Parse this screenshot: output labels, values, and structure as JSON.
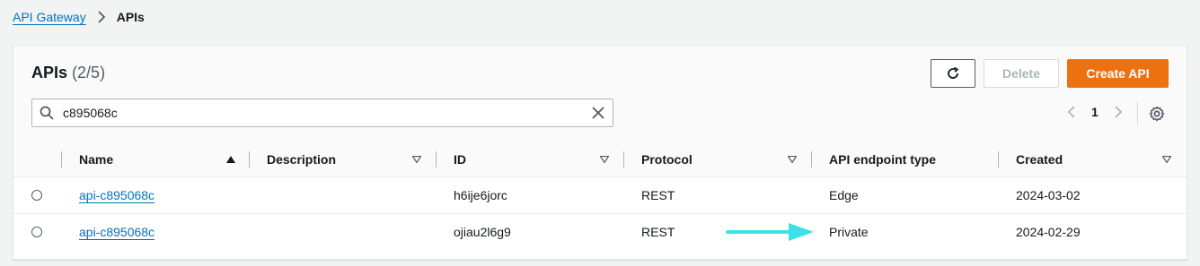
{
  "breadcrumb": {
    "root": "API Gateway",
    "current": "APIs"
  },
  "panel": {
    "title": "APIs",
    "count": "(2/5)"
  },
  "buttons": {
    "delete": "Delete",
    "create": "Create API"
  },
  "search": {
    "value": "c895068c"
  },
  "pagination": {
    "current_page": "1"
  },
  "table": {
    "columns": [
      "Name",
      "Description",
      "ID",
      "Protocol",
      "API endpoint type",
      "Created"
    ],
    "rows": [
      {
        "name": "api-c895068c",
        "description": "",
        "id": "h6ije6jorc",
        "protocol": "REST",
        "endpoint_type": "Edge",
        "created": "2024-03-02"
      },
      {
        "name": "api-c895068c",
        "description": "",
        "id": "ojiau2l6g9",
        "protocol": "REST",
        "endpoint_type": "Private",
        "created": "2024-02-29"
      }
    ]
  },
  "colors": {
    "link": "#0073bb",
    "primary": "#ec7211",
    "annotation_arrow": "#3de0e8"
  }
}
